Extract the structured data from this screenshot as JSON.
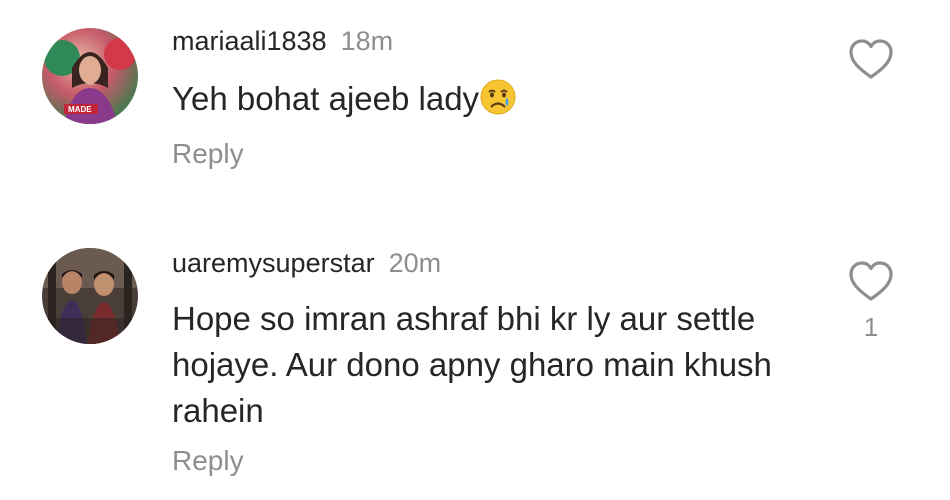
{
  "comments": [
    {
      "username": "mariaali1838",
      "time": "18m",
      "text": "Yeh bohat ajeeb lady",
      "emoji": "crying-face",
      "reply_label": "Reply",
      "like_count": ""
    },
    {
      "username": "uaremysuperstar",
      "time": "20m",
      "text": "Hope so imran ashraf bhi kr ly aur settle hojaye. Aur dono apny gharo main khush rahein",
      "reply_label": "Reply",
      "like_count": "1"
    }
  ],
  "colors": {
    "text": "#262626",
    "secondary": "#8e8e8e",
    "background": "#ffffff"
  },
  "icons": [
    "heart-outline-icon",
    "crying-face-emoji"
  ]
}
